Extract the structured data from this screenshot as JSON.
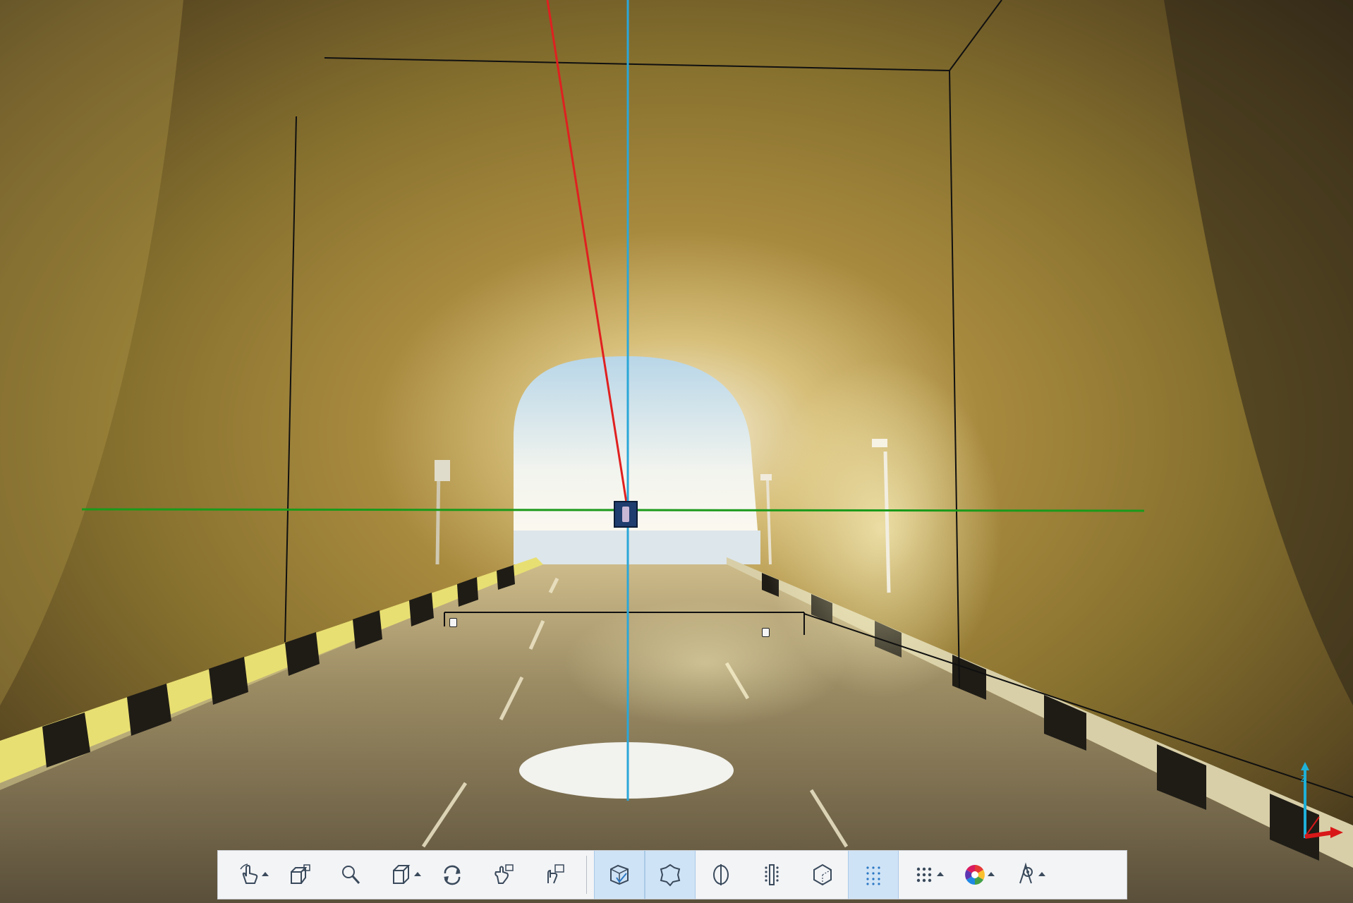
{
  "window": {
    "title": ""
  },
  "colors": {
    "accent": "#2b78c4",
    "active_button_bg": "#cfe3f6",
    "axis_x": "#e02020",
    "axis_y": "#1a9a1a",
    "axis_z": "#2aa7d8"
  },
  "toolbar": {
    "buttons": [
      {
        "id": "select-tool",
        "icon": "pointer-hand-icon",
        "has_dropdown": true,
        "active": false
      },
      {
        "id": "camera-view",
        "icon": "camera-cube-icon",
        "has_dropdown": false,
        "active": false
      },
      {
        "id": "zoom",
        "icon": "magnifier-icon",
        "has_dropdown": false,
        "active": false
      },
      {
        "id": "view-cube",
        "icon": "cube-icon",
        "has_dropdown": true,
        "active": false
      },
      {
        "id": "orbit",
        "icon": "rotate-icon",
        "has_dropdown": false,
        "active": false
      },
      {
        "id": "pan-camera",
        "icon": "hand-camera-icon",
        "has_dropdown": false,
        "active": false
      },
      {
        "id": "walk-camera",
        "icon": "walk-camera-icon",
        "has_dropdown": false,
        "active": false
      },
      {
        "id": "clip-box",
        "icon": "clip-box-icon",
        "has_dropdown": false,
        "active": true
      },
      {
        "id": "clip-shape",
        "icon": "clip-shape-icon",
        "has_dropdown": false,
        "active": true
      },
      {
        "id": "section",
        "icon": "section-icon",
        "has_dropdown": false,
        "active": false
      },
      {
        "id": "slice",
        "icon": "slice-icon",
        "has_dropdown": false,
        "active": false
      },
      {
        "id": "hexagon-view",
        "icon": "hexagon-icon",
        "has_dropdown": false,
        "active": false
      },
      {
        "id": "point-density",
        "icon": "dotted-grid-icon",
        "has_dropdown": false,
        "active": true
      },
      {
        "id": "point-size",
        "icon": "point-grid-icon",
        "has_dropdown": true,
        "active": false
      },
      {
        "id": "color-mode",
        "icon": "color-wheel-icon",
        "has_dropdown": true,
        "active": false
      },
      {
        "id": "visibility",
        "icon": "eye-drop-icon",
        "has_dropdown": true,
        "active": false
      }
    ]
  },
  "gizmo": {
    "axes": [
      "Z",
      "Y",
      "X"
    ]
  }
}
